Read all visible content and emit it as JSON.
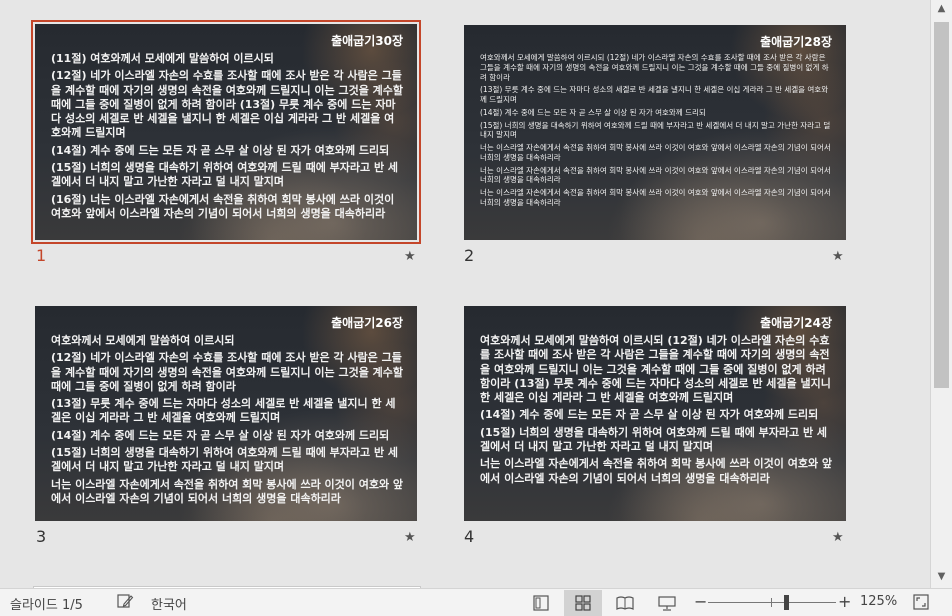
{
  "slides": [
    {
      "number": "1",
      "title": "출애굽기30장",
      "paragraphs": [
        "(11절) 여호와께서 모세에게 말씀하여 이르시되",
        "(12절) 네가 이스라엘 자손의 수효를 조사할 때에 조사 받은 각 사람은 그들을 계수할 때에 자기의 생명의 속전을 여호와께 드릴지니 이는 그것을 계수할 때에 그들 중에 질병이 없게 하려 함이라 (13절) 무릇 계수 중에 드는 자마다 성소의 세겔로 반 세겔을 낼지니 한 세겔은 이십 게라라 그 반 세겔을 여호와께 드릴지며",
        "(14절) 계수 중에 드는 모든 자 곧 스무 살 이상 된 자가 여호와께 드리되",
        "(15절) 너희의 생명을 대속하기 위하여 여호와께 드릴 때에 부자라고 반 세겔에서 더 내지 말고 가난한 자라고 덜 내지 말지며",
        "(16절) 너는 이스라엘 자손에게서 속전을 취하여 회막 봉사에 쓰라 이것이 여호와 앞에서 이스라엘 자손의 기념이 되어서 너희의 생명을 대속하리라"
      ]
    },
    {
      "number": "2",
      "title": "출애굽기28장",
      "paragraphs": [
        "여호와께서 모세에게 말씀하여 이르시되 (12절) 네가 이스라엘 자손의 수효를 조사할 때에 조사 받은 각 사람은 그들을 계수할 때에 자기의 생명의 속전을 여호와께 드릴지니 이는 그것을 계수할 때에 그들 중에 질병이 없게 하려 함이라",
        "(13절) 무릇 계수 중에 드는 자마다 성소의 세겔로 반 세겔을 낼지니 한 세겔은 이십 게라라 그 반 세겔을 여호와께 드릴지며",
        "(14절) 계수 중에 드는 모든 자 곧 스무 살 이상 된 자가 여호와께 드리되",
        "(15절) 너희의 생명을 대속하기 위하여 여호와께 드릴 때에 부자라고 반 세겔에서 더 내지 말고 가난한 자라고 덜 내지 말지며",
        "너는 이스라엘 자손에게서 속전을 취하여 회막 봉사에 쓰라 이것이 여호와 앞에서 이스라엘 자손의 기념이 되어서 너희의 생명을 대속하리라",
        "너는 이스라엘 자손에게서 속전을 취하여 회막 봉사에 쓰라 이것이 여호와 앞에서 이스라엘 자손의 기념이 되어서 너희의 생명을 대속하리라",
        "너는 이스라엘 자손에게서 속전을 취하여 회막 봉사에 쓰라 이것이 여호와 앞에서 이스라엘 자손의 기념이 되어서 너희의 생명을 대속하리라"
      ]
    },
    {
      "number": "3",
      "title": "출애굽기26장",
      "paragraphs": [
        "여호와께서 모세에게 말씀하여 이르시되",
        "(12절) 네가 이스라엘 자손의 수효를 조사할 때에 조사 받은 각 사람은 그들을 계수할 때에 자기의 생명의 속전을 여호와께 드릴지니 이는 그것을 계수할 때에 그들 중에 질병이 없게 하려 함이라",
        "(13절) 무릇 계수 중에 드는 자마다 성소의 세겔로 반 세겔을 낼지니 한 세겔은 이십 게라라 그 반 세겔을 여호와께 드릴지며",
        "(14절) 계수 중에 드는 모든 자 곧 스무 살 이상 된 자가 여호와께 드리되",
        "(15절) 너희의 생명을 대속하기 위하여 여호와께 드릴 때에 부자라고 반 세겔에서 더 내지 말고 가난한 자라고 덜 내지 말지며",
        "너는 이스라엘 자손에게서 속전을 취하여 회막 봉사에 쓰라 이것이 여호와 앞에서 이스라엘 자손의 기념이 되어서 너희의 생명을 대속하리라"
      ]
    },
    {
      "number": "4",
      "title": "출애굽기24장",
      "paragraphs": [
        "여호와께서 모세에게 말씀하여 이르시되 (12절) 네가 이스라엘 자손의 수효를 조사할 때에 조사 받은 각 사람은 그들을 계수할 때에 자기의 생명의 속전을 여호와께 드릴지니 이는 그것을 계수할 때에 그들 중에 질병이 없게 하려 함이라 (13절) 무릇 계수 중에 드는 자마다 성소의 세겔로 반 세겔을 낼지니 한 세겔은 이십 게라라 그 반 세겔을 여호와께 드릴지며",
        "(14절) 계수 중에 드는 모든 자 곧 스무 살 이상 된 자가 여호와께 드리되",
        "(15절) 너희의 생명을 대속하기 위하여 여호와께 드릴 때에 부자라고 반 세겔에서 더 내지 말고 가난한 자라고 덜 내지 말지며",
        "너는 이스라엘 자손에게서 속전을 취하여 회막 봉사에 쓰라 이것이 여호와 앞에서 이스라엘 자손의 기념이 되어서 너희의 생명을 대속하리라"
      ]
    }
  ],
  "star_icon": "star-icon",
  "status": {
    "slide_counter": "슬라이드 1/5",
    "language": "한국어",
    "zoom_minus": "−",
    "zoom_plus": "+",
    "zoom_level": "125%"
  },
  "colors": {
    "selection": "#c4462a",
    "active_view": "#d2d2d2"
  }
}
